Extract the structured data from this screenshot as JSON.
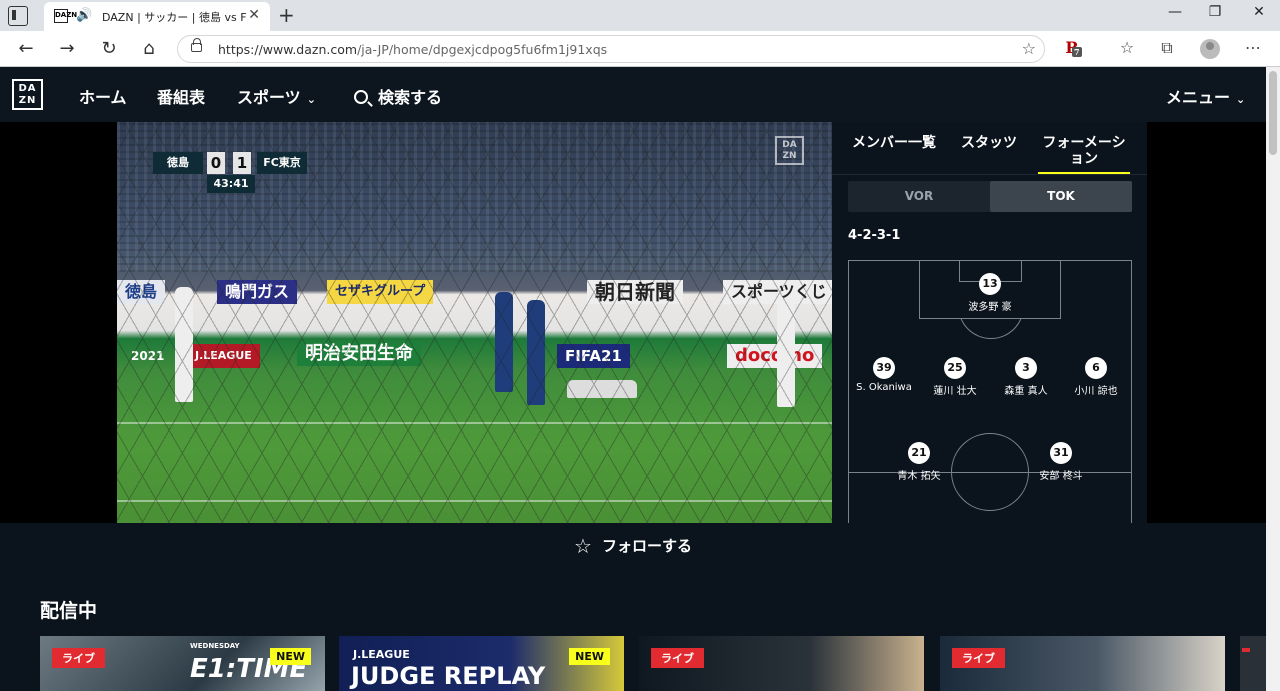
{
  "browser": {
    "tab_title": "DAZN | サッカー | 徳島 vs FC東京",
    "tab_favicon": "DAZN",
    "url_host": "https://www.dazn.com",
    "url_path": "/ja-JP/home/dpgexjcdpog5fu6fm1j91xqs",
    "extension_badge": "7"
  },
  "nav": {
    "logo_top": "DA",
    "logo_bottom": "ZN",
    "home": "ホーム",
    "schedule": "番組表",
    "sports": "スポーツ",
    "search": "検索する",
    "menu": "メニュー"
  },
  "video": {
    "home_team": "徳島",
    "home_score": "0",
    "away_score": "1",
    "away_team": "FC東京",
    "clock": "43:41",
    "watermark_top": "DA",
    "watermark_bottom": "ZN",
    "boards": [
      "徳島",
      "鳴門ガス",
      "セザキグループ",
      "朝日新聞",
      "スポーツくじ",
      "明治安田生命",
      "FIFA21",
      "docomo",
      "2021",
      "J.LEAGUE"
    ]
  },
  "sidebar": {
    "tabs": [
      "メンバー一覧",
      "スタッツ",
      "フォーメーション"
    ],
    "toggle": [
      "VOR",
      "TOK"
    ],
    "formation": "4-2-3-1",
    "players": [
      {
        "num": "13",
        "name": "波多野 豪"
      },
      {
        "num": "39",
        "name": "S. Okaniwa"
      },
      {
        "num": "25",
        "name": "蓮川 壮大"
      },
      {
        "num": "3",
        "name": "森重 真人"
      },
      {
        "num": "6",
        "name": "小川 諒也"
      },
      {
        "num": "21",
        "name": "青木 拓矢"
      },
      {
        "num": "31",
        "name": "安部 柊斗"
      }
    ]
  },
  "follow_label": "フォローする",
  "section": {
    "title": "配信中",
    "live": "ライブ",
    "new": "NEW",
    "card1_text": "E1:TIME",
    "card1_small": "WEDNESDAY",
    "card2_top": "J.LEAGUE",
    "card2_main": "JUDGE REPLAY"
  },
  "colors": {
    "bg": "#0b141c",
    "accent_yellow": "#f7ff1a",
    "live_red": "#e22b30"
  }
}
